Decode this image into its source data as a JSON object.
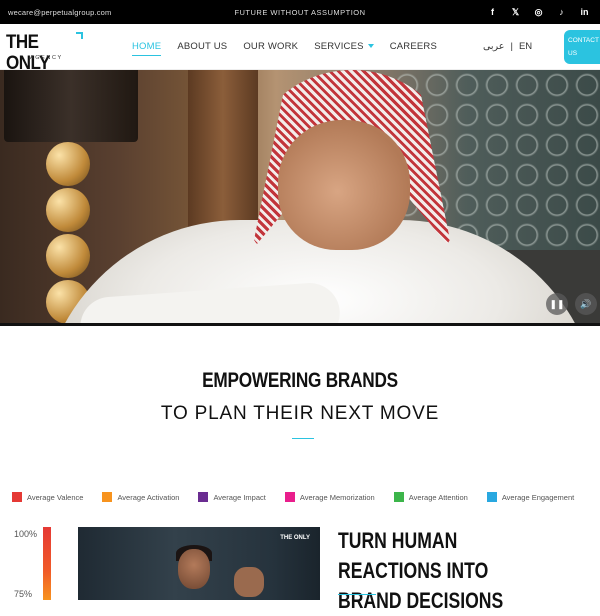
{
  "topbar": {
    "email": "wecare@perpetualgroup.com",
    "tagline": "FUTURE WITHOUT ASSUMPTION",
    "socials": [
      {
        "icon": "facebook-icon",
        "glyph": "f"
      },
      {
        "icon": "x-twitter-icon",
        "glyph": "𝕏"
      },
      {
        "icon": "instagram-icon",
        "glyph": "◎"
      },
      {
        "icon": "tiktok-icon",
        "glyph": "♪"
      },
      {
        "icon": "linkedin-icon",
        "glyph": "in"
      }
    ]
  },
  "header": {
    "logo": {
      "main": "THE ONLY",
      "sub": "AGENCY"
    },
    "nav": [
      {
        "label": "HOME",
        "active": true
      },
      {
        "label": "ABOUT US"
      },
      {
        "label": "OUR WORK"
      },
      {
        "label": "SERVICES",
        "dropdown": true
      },
      {
        "label": "CAREERS"
      }
    ],
    "lang": {
      "arabic": "عربى",
      "separator": "|",
      "english": "EN"
    },
    "contact_line1": "CONTACT",
    "contact_line2": "US"
  },
  "hero": {
    "controls": {
      "pause_glyph": "❚❚",
      "sound_glyph": "🔊"
    }
  },
  "section": {
    "title": "EMPOWERING BRANDS",
    "subtitle": "TO PLAN THEIR NEXT MOVE"
  },
  "legend": [
    {
      "label": "Average Valence",
      "color": "#e53935"
    },
    {
      "label": "Average Activation",
      "color": "#f7931e"
    },
    {
      "label": "Average Impact",
      "color": "#6a2c91"
    },
    {
      "label": "Average Memorization",
      "color": "#e91e8c"
    },
    {
      "label": "Average Attention",
      "color": "#3cb54a"
    },
    {
      "label": "Average Engagement",
      "color": "#29a8e0"
    }
  ],
  "chart_axis": {
    "top_label": "100%",
    "mid_label": "75%"
  },
  "video_card": {
    "brand": "THE ONLY"
  },
  "cta": {
    "title_line1": "TURN HUMAN REACTIONS INTO",
    "title_line2": "BRAND DECISIONS"
  },
  "colors": {
    "accent": "#2bc3e0",
    "topbar": "#000000"
  }
}
